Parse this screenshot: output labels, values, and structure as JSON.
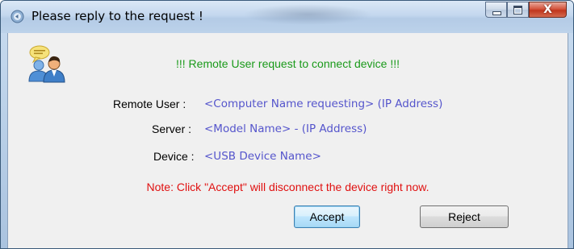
{
  "window": {
    "title": "Please reply to the request !",
    "controls": {
      "minimize_icon": "minimize-icon",
      "maximize_icon": "maximize-icon",
      "close_label": "X"
    }
  },
  "dialog": {
    "headline": "!!! Remote User request to connect device !!!",
    "fields": [
      {
        "label": "Remote User :",
        "value": "<Computer Name requesting> (IP Address)"
      },
      {
        "label": "Server :",
        "value": "<Model Name> - (IP Address)"
      },
      {
        "label": "Device :",
        "value": "<USB Device Name>"
      }
    ],
    "note": "Note: Click \"Accept\" will disconnect the device right now.",
    "accept_label": "Accept",
    "reject_label": "Reject"
  },
  "colors": {
    "headline": "#1a9a1a",
    "value_text": "#5555cc",
    "note": "#e01010"
  }
}
